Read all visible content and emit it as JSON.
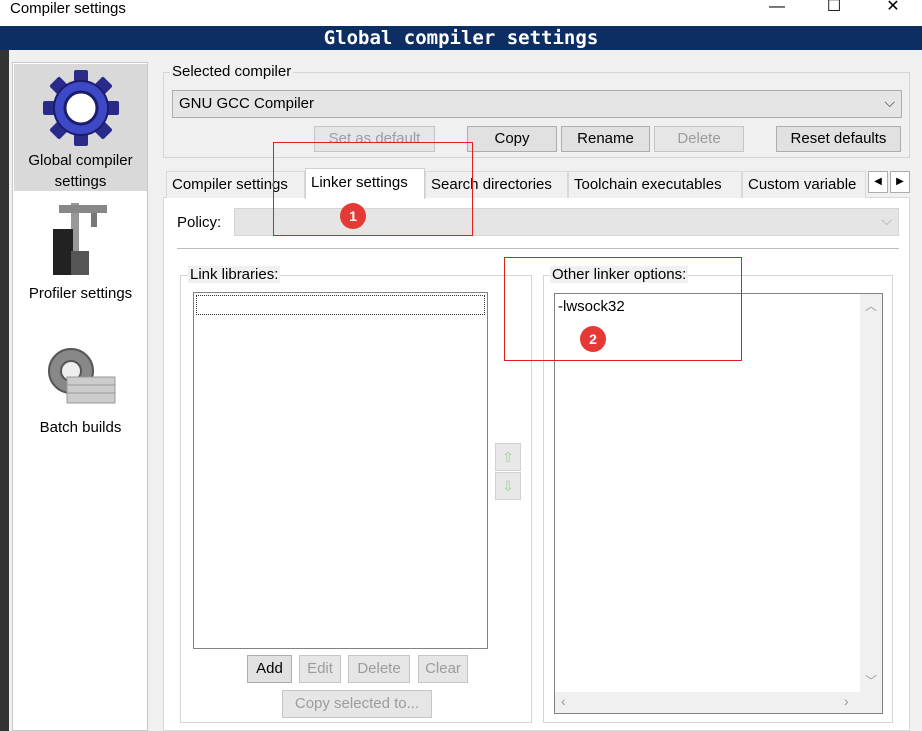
{
  "window": {
    "title": "Compiler settings",
    "minimize_glyph": "—",
    "maximize_glyph": "☐",
    "close_glyph": "✕"
  },
  "banner": {
    "title": "Global compiler settings"
  },
  "sidebar": {
    "items": [
      {
        "label": "Global compiler settings",
        "icon": "gear-icon",
        "selected": true
      },
      {
        "label": "Profiler settings",
        "icon": "caliper-icon",
        "selected": false
      },
      {
        "label": "Batch builds",
        "icon": "batch-icon",
        "selected": false
      }
    ]
  },
  "selected_compiler": {
    "label": "Selected compiler",
    "value": "GNU GCC Compiler",
    "arrow": "⌵"
  },
  "buttons": {
    "set_default": "Set as default",
    "copy": "Copy",
    "rename": "Rename",
    "delete": "Delete",
    "reset": "Reset defaults"
  },
  "tabs": [
    {
      "label": "Compiler settings",
      "active": false
    },
    {
      "label": "Linker settings",
      "active": true
    },
    {
      "label": "Search directories",
      "active": false
    },
    {
      "label": "Toolchain executables",
      "active": false
    },
    {
      "label": "Custom variable",
      "active": false
    }
  ],
  "tab_scroll": {
    "left": "◀",
    "right": "▶"
  },
  "policy": {
    "label": "Policy:",
    "value": "",
    "arrow": "⌵"
  },
  "link_libraries": {
    "label": "Link libraries:",
    "items": [
      ""
    ],
    "add": "Add",
    "edit": "Edit",
    "delete": "Delete",
    "clear": "Clear",
    "copy_selected": "Copy selected to...",
    "move_up": "⇧",
    "move_down": "⇩"
  },
  "other_options": {
    "label": "Other linker options:",
    "text": "-lwsock32",
    "scroll_up": "︿",
    "scroll_down": "﹀",
    "scroll_left": "‹",
    "scroll_right": "›"
  },
  "annotations": {
    "marker1": "1",
    "marker2": "2"
  },
  "colors": {
    "banner_bg": "#0c2e62",
    "annotation_red": "#e53935"
  }
}
